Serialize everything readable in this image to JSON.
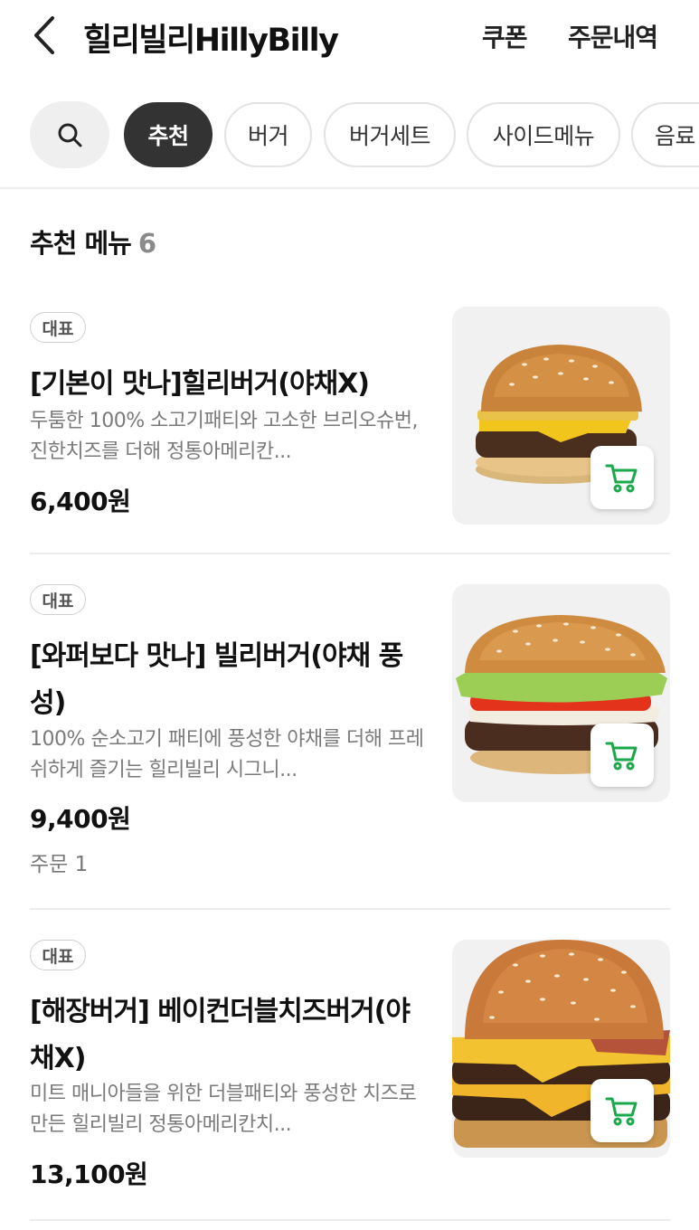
{
  "header": {
    "store_title": "힐리빌리HillyBilly",
    "coupon_label": "쿠폰",
    "orders_label": "주문내역"
  },
  "categories": [
    "추천",
    "버거",
    "버거세트",
    "사이드메뉴",
    "음료"
  ],
  "active_category": "추천",
  "section": {
    "title": "추천 메뉴",
    "count": "6"
  },
  "items": [
    {
      "badge": "대표",
      "name": "[기본이 맛나]힐리버거(야채X)",
      "description": "두툼한 100% 소고기패티와 고소한 브리오슈번, 진한치즈를 더해 정통아메리칸...",
      "price": "6,400원",
      "orders": ""
    },
    {
      "badge": "대표",
      "name": "[와퍼보다 맛나] 빌리버거(야채 풍성)",
      "description": "100% 순소고기 패티에 풍성한 야채를 더해 프레쉬하게 즐기는 힐리빌리 시그니...",
      "price": "9,400원",
      "orders": "주문 1"
    },
    {
      "badge": "대표",
      "name": "[해장버거] 베이컨더블치즈버거(야채X)",
      "description": "미트 매니아들을 위한 더블패티와 풍성한 치즈로 만든 힐리빌리 정통아메리칸치...",
      "price": "13,100원",
      "orders": ""
    }
  ],
  "colors": {
    "cart_icon": "#1aa84b",
    "active_chip": "#333333"
  },
  "icons": {
    "back": "chevron-left-icon",
    "search": "search-icon",
    "cart": "cart-icon"
  }
}
